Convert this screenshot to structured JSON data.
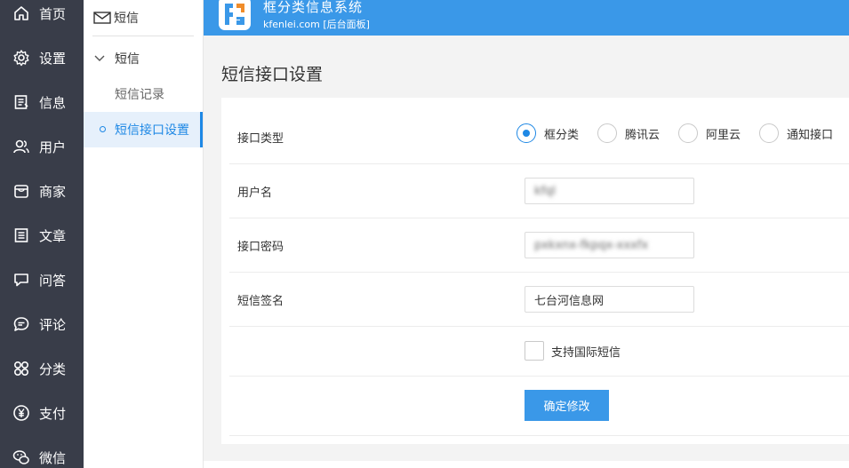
{
  "nav": {
    "items": [
      {
        "label": "首页",
        "icon": "home-icon"
      },
      {
        "label": "设置",
        "icon": "gear-icon"
      },
      {
        "label": "信息",
        "icon": "document-icon"
      },
      {
        "label": "用户",
        "icon": "user-icon"
      },
      {
        "label": "商家",
        "icon": "store-icon"
      },
      {
        "label": "文章",
        "icon": "article-icon"
      },
      {
        "label": "问答",
        "icon": "chat-icon"
      },
      {
        "label": "评论",
        "icon": "comment-icon"
      },
      {
        "label": "分类",
        "icon": "category-icon"
      },
      {
        "label": "支付",
        "icon": "yen-icon"
      },
      {
        "label": "微信",
        "icon": "wechat-icon"
      }
    ]
  },
  "submenu": {
    "header": "短信",
    "group": "短信",
    "links": [
      "短信记录",
      "短信接口设置"
    ],
    "active_index": 1
  },
  "header": {
    "brand": "框分类信息系统",
    "subtitle": "kfenlei.com [后台面板]"
  },
  "page": {
    "title": "短信接口设置"
  },
  "form": {
    "interface_type": {
      "label": "接口类型",
      "options": [
        "框分类",
        "腾讯云",
        "阿里云",
        "通知接口"
      ],
      "selected": "框分类"
    },
    "username": {
      "label": "用户名",
      "value": "kfql"
    },
    "password": {
      "label": "接口密码",
      "value": "pxkxnx-fkpqx-xxxfx"
    },
    "signature": {
      "label": "短信签名",
      "value": "七台河信息网"
    },
    "international": {
      "label": "支持国际短信",
      "checked": false
    },
    "submit_label": "确定修改"
  },
  "colors": {
    "nav_bg": "#393d49",
    "accent": "#3a98e8",
    "active_bg": "#e6f0fb"
  }
}
